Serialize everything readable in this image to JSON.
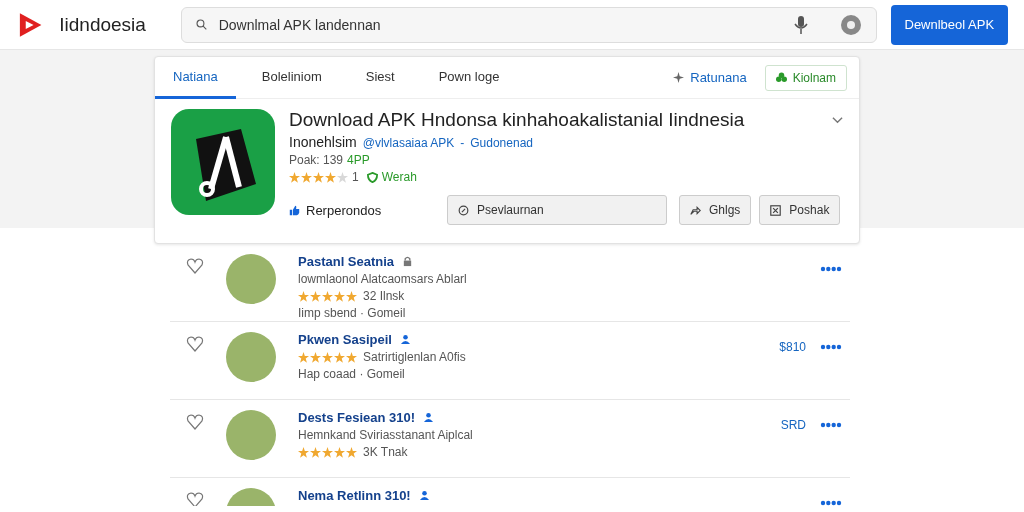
{
  "header": {
    "brand": "Iidndoesia",
    "search": {
      "value": "Downlmal APK landennan"
    },
    "button": "Dewnlbeol APK"
  },
  "tabs": [
    {
      "label": "Natiana",
      "selected": true
    },
    {
      "label": "Boleliniom",
      "selected": false
    },
    {
      "label": "Siest",
      "selected": false
    },
    {
      "label": "Pown loge",
      "selected": false
    }
  ],
  "tab_actions": {
    "link": "Ratunana",
    "button": "Kiolnam"
  },
  "app": {
    "title": "Download APK Hndonsa kinhahoakalistanial Iindnesia",
    "subtitle": "Inonehlsim",
    "developer": "@vlvlasaiaa APK",
    "separator": "-",
    "category": "Gudonenad",
    "size_label": "Poak: 139",
    "size_tag": "4PP",
    "stars": 4,
    "rating_count": "1",
    "verified": "Werah",
    "recommend": "Rerperondos",
    "buttons": [
      {
        "label": "Psevlaurnan",
        "kind": "wide"
      },
      {
        "label": "Ghlgs",
        "kind": "share"
      },
      {
        "label": "Poshak",
        "kind": "flag"
      }
    ]
  },
  "reviews": [
    {
      "name": "Pastanl Seatnia",
      "kind": "lock",
      "lines": [
        {
          "kind": "text",
          "text": "lowmlaonol Alatcaomsars Ablarl"
        },
        {
          "kind": "stars",
          "stars": 5,
          "text": "32 Ilnsk"
        },
        {
          "kind": "meta",
          "text": "Iimp sbend · Gomeil"
        }
      ]
    },
    {
      "name": "Pkwen Sasipeil",
      "kind": "verified",
      "price": "$810",
      "lines": [
        {
          "kind": "stars",
          "stars": 5,
          "text": "Satrirtiglenlan A0fis"
        },
        {
          "kind": "meta",
          "text": "Hap coaad · Gomeil"
        }
      ]
    },
    {
      "name": "Dests Fesiean 310!",
      "kind": "verified",
      "price": "SRD",
      "lines": [
        {
          "kind": "text",
          "text": "Hemnkand Sviriasstanant Aiplcal"
        },
        {
          "kind": "stars",
          "stars": 5,
          "text": "3K Tnak"
        }
      ]
    },
    {
      "name": "Nema Retlinn 310!",
      "kind": "verified"
    }
  ]
}
